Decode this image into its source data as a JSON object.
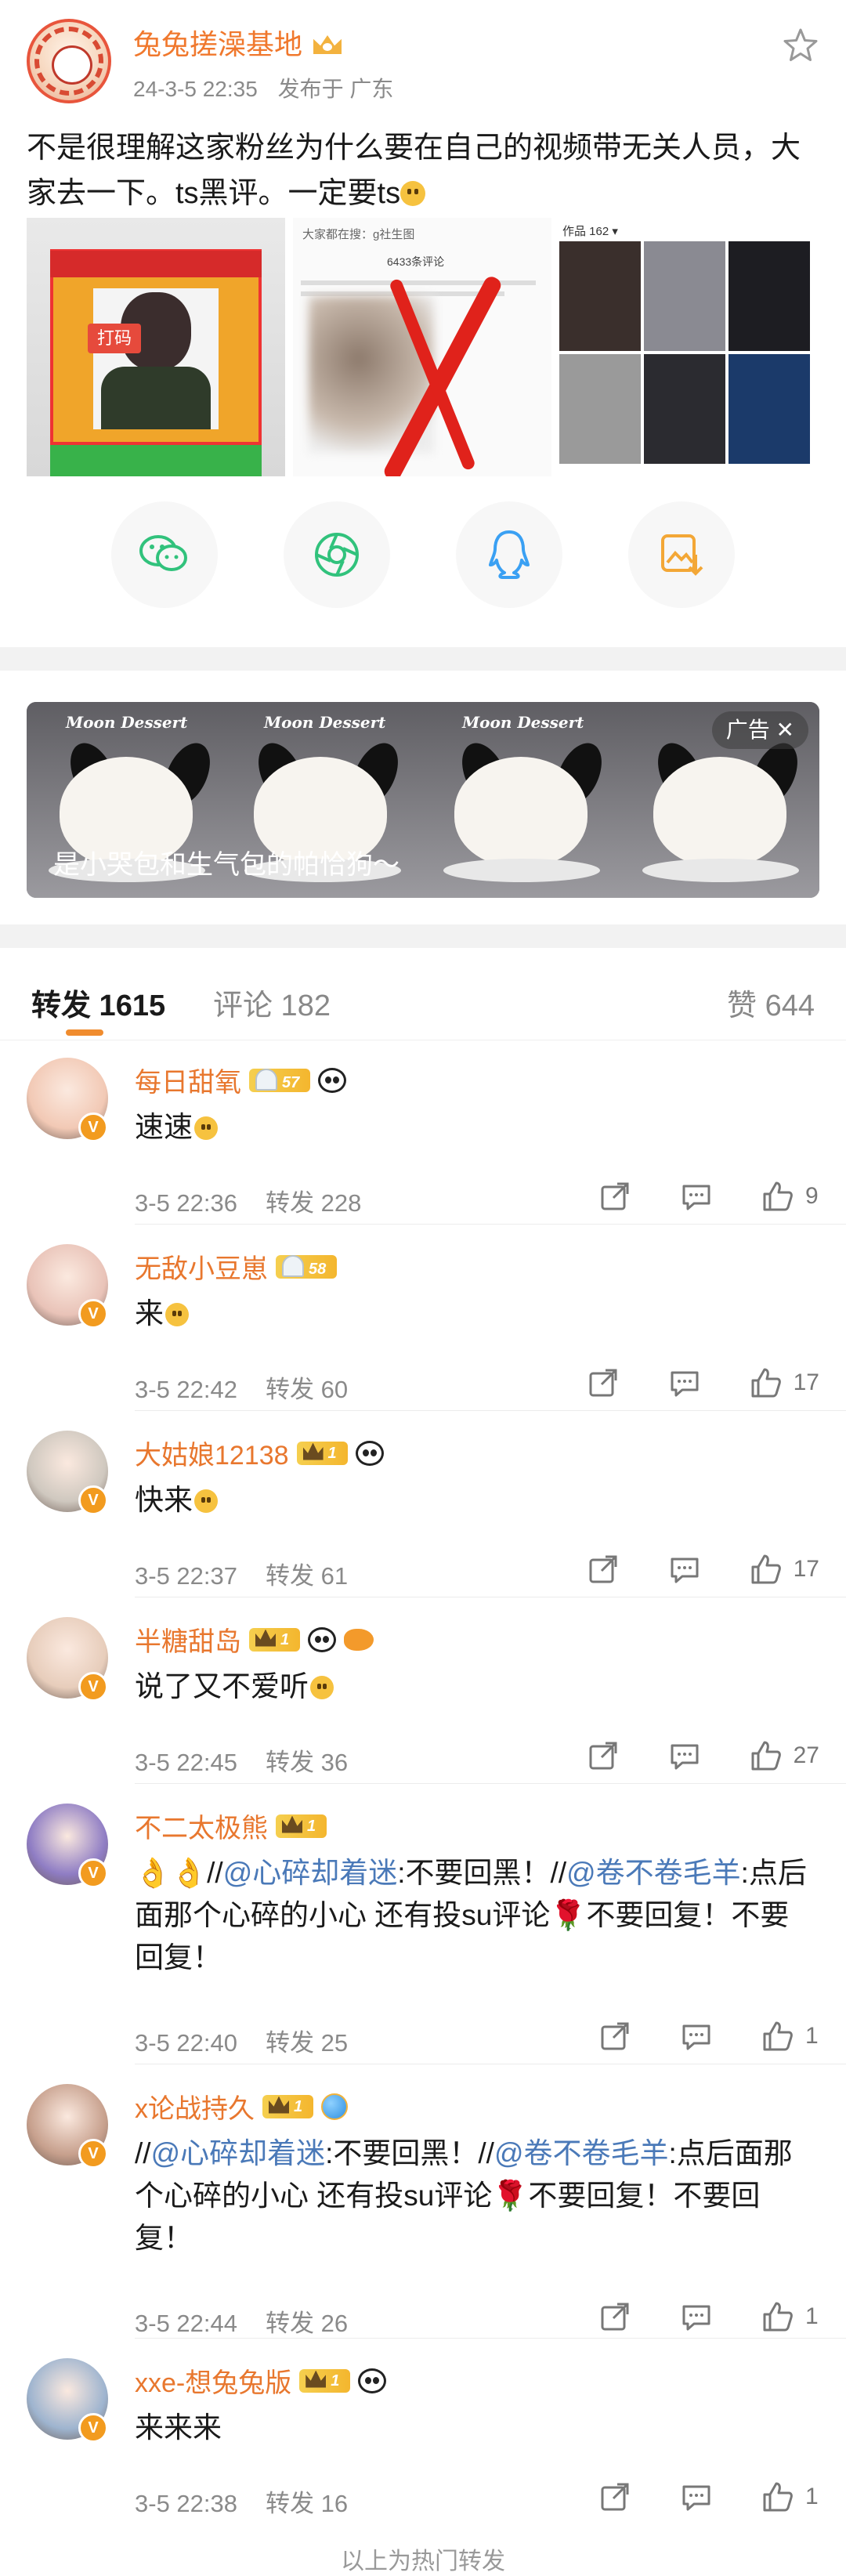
{
  "post": {
    "author": "兔兔搓澡基地",
    "time": "24-3-5 22:35",
    "location": "发布于 广东",
    "text": "不是很理解这家粉丝为什么要在自己的视频带无关人员，大家去一下。ts黑评。一定要ts",
    "image1_tag": "打码",
    "image2_header": "大家都在搜：g社生图",
    "image2_count": "6433条评论",
    "image3_header": "作品 162 ▾"
  },
  "share": {
    "icons": [
      "wechat-icon",
      "moments-icon",
      "qq-icon",
      "save-image-icon"
    ],
    "colors": [
      "#31c27c",
      "#31c27c",
      "#3aa0f3",
      "#f3a736"
    ]
  },
  "ad": {
    "caption": "是小哭包和生气包的帕恰狗～",
    "badge": "广告",
    "label": "Moon Dessert"
  },
  "tabs": {
    "repost": "转发 1615",
    "comments": "评论 182",
    "likes": "赞 644"
  },
  "comments": [
    {
      "name": "每日甜氧",
      "level": "57",
      "level_style": "rocket",
      "extras": [
        "panda"
      ],
      "text": "速速",
      "emoji": true,
      "time": "3-5 22:36",
      "reposts": "转发 228",
      "likes": "9",
      "avatar": "#f2c9b5"
    },
    {
      "name": "无敌小豆崽",
      "level": "58",
      "level_style": "rocket",
      "extras": [],
      "text": "来",
      "emoji": true,
      "time": "3-5 22:42",
      "reposts": "转发 60",
      "likes": "17",
      "avatar": "#e9c3b8"
    },
    {
      "name": "大姑娘12138",
      "level": "1",
      "level_style": "gold",
      "extras": [
        "panda"
      ],
      "text": "快来",
      "emoji": true,
      "time": "3-5 22:37",
      "reposts": "转发 61",
      "likes": "17",
      "avatar": "#cfc8bf"
    },
    {
      "name": "半糖甜岛",
      "level": "1",
      "level_style": "gold",
      "extras": [
        "panda",
        "fish"
      ],
      "text": "说了又不爱听",
      "emoji": true,
      "time": "3-5 22:45",
      "reposts": "转发 36",
      "likes": "27",
      "avatar": "#e7cdbb"
    },
    {
      "name": "不二太极熊",
      "level": "1",
      "level_style": "gold",
      "extras": [],
      "text_parts": [
        "👌👌//",
        "@心碎却着迷",
        ":不要回黑！//",
        "@卷不卷毛羊",
        ":点后面那个心碎的小心 还有投su评论🌹不要回复！不要回复！"
      ],
      "time": "3-5 22:40",
      "reposts": "转发 25",
      "likes": "1",
      "avatar": "#8f7dc4"
    },
    {
      "name": "x论战持久",
      "level": "1",
      "level_style": "gold",
      "extras": [
        "globe"
      ],
      "text_parts": [
        "//",
        "@心碎却着迷",
        ":不要回黑！//",
        "@卷不卷毛羊",
        ":点后面那个心碎的小心 还有投su评论🌹不要回复！不要回复！"
      ],
      "time": "3-5 22:44",
      "reposts": "转发 26",
      "likes": "1",
      "avatar": "#c7a08d"
    },
    {
      "name": "xxe-想兔兔版",
      "level": "1",
      "level_style": "gold",
      "extras": [
        "panda"
      ],
      "text": "来来来",
      "emoji": false,
      "time": "3-5 22:38",
      "reposts": "转发 16",
      "likes": "1",
      "avatar": "#9eb4cf"
    }
  ],
  "footer": "以上为热门转发"
}
